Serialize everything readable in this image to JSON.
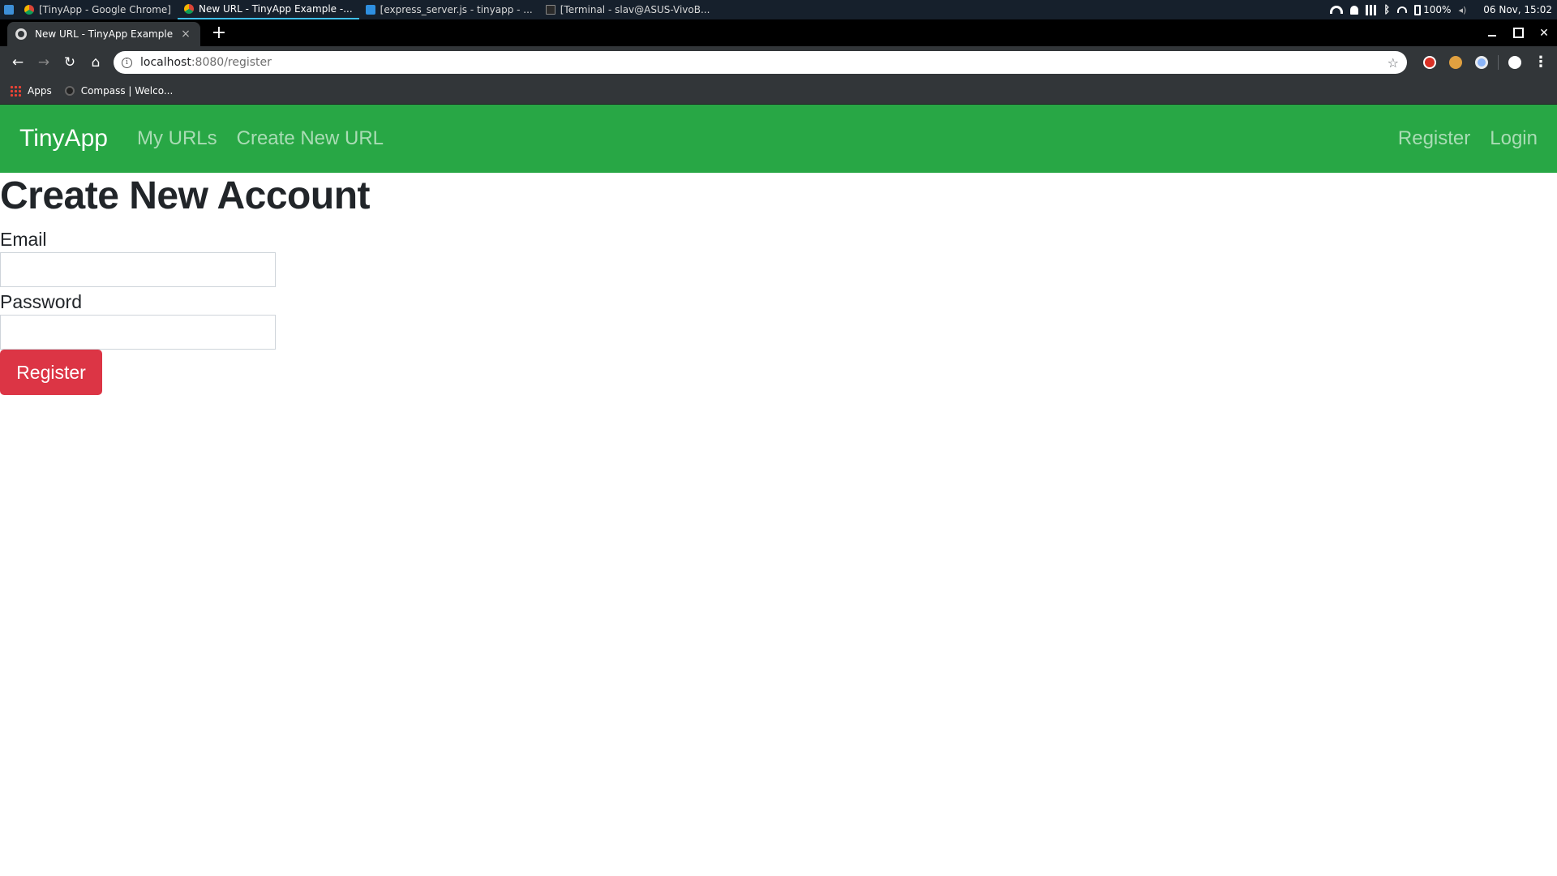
{
  "taskbar": {
    "tasks": [
      {
        "label": "[TinyApp - Google Chrome]",
        "icon": "chrome-icon"
      },
      {
        "label": "New URL - TinyApp Example -...",
        "icon": "chrome-icon"
      },
      {
        "label": "[express_server.js - tinyapp - ...",
        "icon": "vscode-icon"
      },
      {
        "label": "[Terminal - slav@ASUS-VivoB...",
        "icon": "terminal-icon"
      }
    ],
    "battery": "100%",
    "clock": "06 Nov, 15:02"
  },
  "browser": {
    "tab_title": "New URL - TinyApp Example",
    "tab_close": "×",
    "new_tab": "+",
    "url_host": "localhost",
    "url_path": ":8080/register",
    "bookmarks": [
      {
        "label": "Apps",
        "icon": "apps-grid-icon"
      },
      {
        "label": "Compass | Welco...",
        "icon": "compass-favicon-icon"
      }
    ]
  },
  "navbar": {
    "brand": "TinyApp",
    "links": [
      "My URLs",
      "Create New URL"
    ],
    "right_links": [
      "Register",
      "Login"
    ],
    "color": "#28a745"
  },
  "form": {
    "heading": "Create New Account",
    "email_label": "Email",
    "email_value": "",
    "password_label": "Password",
    "password_value": "",
    "submit_label": "Register",
    "submit_color": "#dc3545"
  }
}
